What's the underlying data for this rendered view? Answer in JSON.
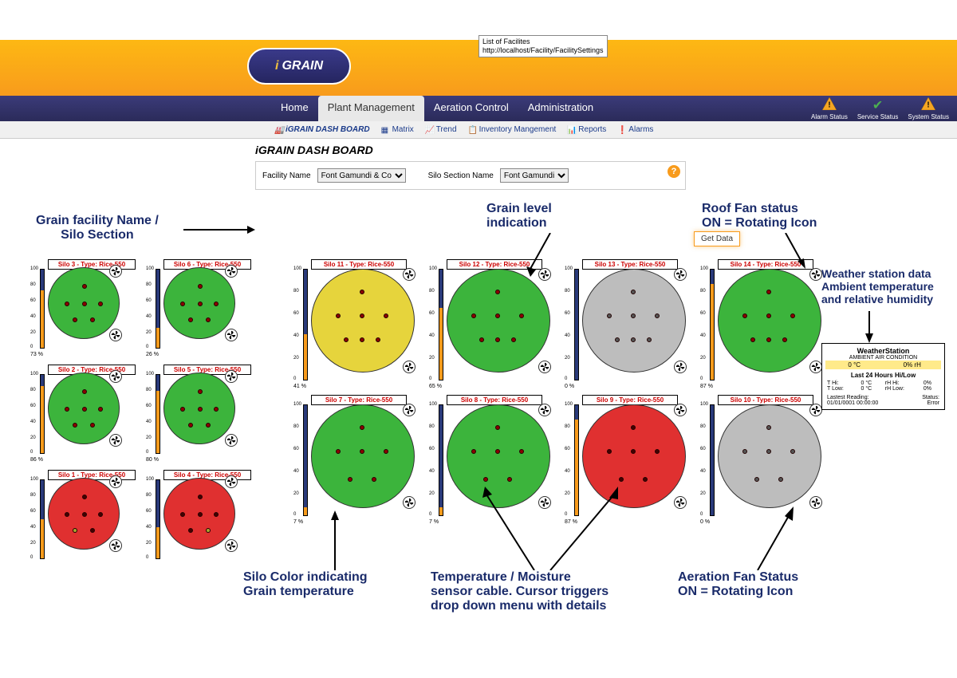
{
  "tooltip": {
    "line1": "List of Facilites",
    "line2": "http://localhost/Facility/FacilitySettings"
  },
  "logo": {
    "prefix": "i",
    "text": "GRAIN"
  },
  "nav": {
    "home": "Home",
    "plant": "Plant Management",
    "aeration": "Aeration Control",
    "admin": "Administration"
  },
  "status": {
    "alarm": "Alarm Status",
    "service": "Service Status",
    "system": "System Status"
  },
  "subnav": {
    "dash": "iGRAIN DASH BOARD",
    "matrix": "Matrix",
    "trend": "Trend",
    "inventory": "Inventory Mangement",
    "reports": "Reports",
    "alarms": "Alarms"
  },
  "dashboard": {
    "title": "iGRAIN DASH BOARD",
    "facility_label": "Facility Name",
    "facility_value": "Font Gamundi & Co",
    "section_label": "Silo Section Name",
    "section_value": "Font Gamundi",
    "get_data": "Get Data"
  },
  "silos": {
    "s3": {
      "label": "Silo 3 - Type: Rice-550",
      "pct": "73 %"
    },
    "s6": {
      "label": "Silo 6 - Type: Rice-550",
      "pct": "26 %"
    },
    "s11": {
      "label": "Silo 11 - Type: Rice-550",
      "pct": "41 %"
    },
    "s12": {
      "label": "Silo 12 - Type: Rice-550",
      "pct": "65 %"
    },
    "s13": {
      "label": "Silo 13 - Type: Rice-550",
      "pct": "0 %"
    },
    "s14": {
      "label": "Silo 14 - Type: Rice-550",
      "pct": "87 %"
    },
    "s2": {
      "label": "Silo 2 - Type: Rice-550",
      "pct": "86 %"
    },
    "s5": {
      "label": "Silo 5 - Type: Rice-550",
      "pct": "80 %"
    },
    "s7": {
      "label": "Silo 7 - Type: Rice-550",
      "pct": "7 %"
    },
    "s8": {
      "label": "Silo 8 - Type: Rice-550",
      "pct": "7 %"
    },
    "s9": {
      "label": "Silo 9 - Type: Rice-550",
      "pct": "87 %"
    },
    "s10": {
      "label": "Silo 10 - Type: Rice-550",
      "pct": "0 %"
    },
    "s1": {
      "label": "Silo 1 - Type: Rice-550",
      "pct": ""
    },
    "s4": {
      "label": "Silo 4 - Type: Rice-550",
      "pct": ""
    }
  },
  "ticks": {
    "t100": "100",
    "t80": "80",
    "t60": "60",
    "t40": "40",
    "t20": "20",
    "t0": "0"
  },
  "weather": {
    "title": "WeatherStation",
    "subtitle": "AMBIENT AIR CONDITION",
    "temp": "0 °C",
    "rh": "0% rH",
    "hilow_title": "Last 24 Hours Hi/Low",
    "thi_l": "T Hi:",
    "thi_v": "0 °C",
    "tlow_l": "T Low:",
    "tlow_v": "0 °C",
    "rhi_l": "rH Hi:",
    "rhi_v": "0%",
    "rlow_l": "rH Low:",
    "rlow_v": "0%",
    "last_l": "Lastest Reading:",
    "status_l": "Status:",
    "last_v": "01/01/0001 00:00:00",
    "status_v": "Error"
  },
  "annotations": {
    "facility": "Grain facility Name /\nSilo Section",
    "grain_level": "Grain level\nindication",
    "roof_fan": "Roof Fan status\nON = Rotating Icon",
    "weather": "Weather station data\nAmbient temperature\nand relative humidity",
    "silo_color": "Silo Color indicating\nGrain temperature",
    "sensor": "Temperature / Moisture\nsensor cable. Cursor triggers\ndrop down menu with details",
    "aeration": "Aeration Fan Status\nON = Rotating Icon"
  }
}
